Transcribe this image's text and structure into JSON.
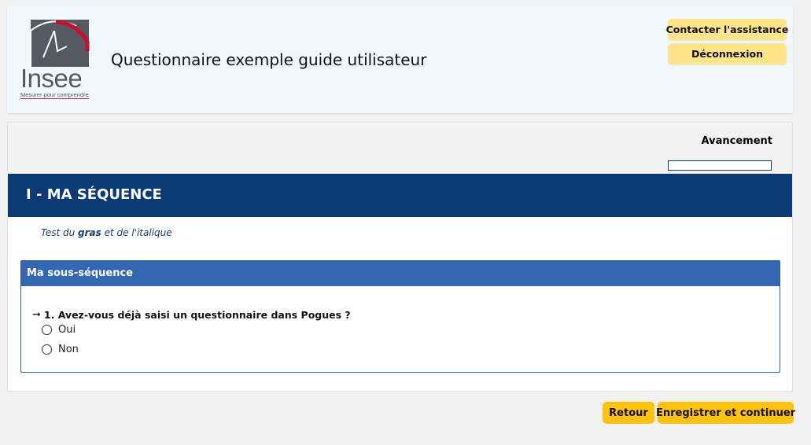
{
  "header": {
    "logo_text": "Insee",
    "logo_tagline": "Mesurer pour comprendre",
    "title": "Questionnaire exemple guide utilisateur",
    "assistance_label": "Contacter l'assistance",
    "logout_label": "Déconnexion"
  },
  "progress": {
    "label": "Avancement",
    "fraction": 0
  },
  "sequence": {
    "title": "I - MA SÉQUENCE",
    "declaration_before": "Test du ",
    "declaration_bold": "gras",
    "declaration_after": " et de l'italique"
  },
  "subsequence": {
    "title": "Ma sous-séquence",
    "question": "1. Avez-vous déjà saisi un questionnaire dans Pogues ?",
    "options": [
      {
        "label": "Oui",
        "selected": false
      },
      {
        "label": "Non",
        "selected": false
      }
    ]
  },
  "footer": {
    "back_label": "Retour",
    "next_label": "Enregistrer et continuer"
  },
  "icons": {
    "question_arrow": "arrow-right-icon"
  },
  "colors": {
    "header_bg": "#f0f8fc",
    "sequence_bg": "#0e3a73",
    "subsequence_bg": "#3467b1",
    "header_button": "#ffe48c",
    "footer_button": "#ffc30f",
    "logo_accent": "#c8102e"
  }
}
